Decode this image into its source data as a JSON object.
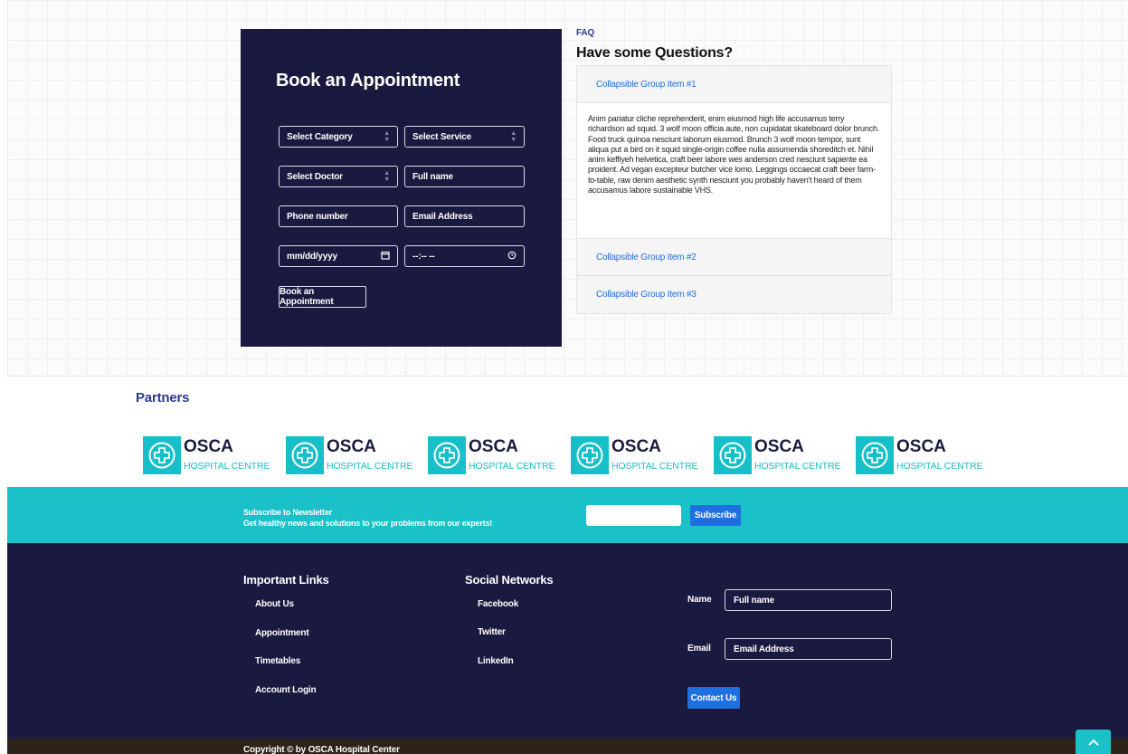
{
  "appointment": {
    "title": "Book an Appointment",
    "category_select": "Select Category",
    "service_select": "Select Service",
    "doctor_select": "Select Doctor",
    "fullname_placeholder": "Full name",
    "phone_placeholder": "Phone number",
    "email_placeholder": "Email Address",
    "date_placeholder": "mm/dd/yyyy",
    "time_placeholder": "--:-- --",
    "submit_label": "Book an Appointment"
  },
  "faq": {
    "label": "FAQ",
    "title": "Have some Questions?",
    "items": [
      {
        "title": "Collapsible Group Item #1",
        "body": "Anim pariatur cliche reprehenderit, enim eiusmod high life accusamus terry richardson ad squid. 3 wolf moon officia aute, non cupidatat skateboard dolor brunch. Food truck quinoa nesciunt laborum eiusmod. Brunch 3 wolf moon tempor, sunt aliqua put a bird on it squid single-origin coffee nulla assumenda shoreditch et. Nihil anim keffiyeh helvetica, craft beer labore wes anderson cred nesciunt sapiente ea proident. Ad vegan excepteur butcher vice lomo. Leggings occaecat craft beer farm-to-table, raw denim aesthetic synth nesciunt you probably haven't heard of them accusamus labore sustainable VHS."
      },
      {
        "title": "Collapsible Group Item #2"
      },
      {
        "title": "Collapsible Group Item #3"
      }
    ]
  },
  "partners": {
    "title": "Partners",
    "logo_name": "OSCA",
    "logo_sub": "HOSPITAL CENTRE",
    "brand_color": "#17bfc8"
  },
  "newsletter": {
    "line1": "Subscribe to Newsletter",
    "line2": "Get healthy news and solutions to your problems from our experts!",
    "button": "Subscribe"
  },
  "footer": {
    "important_title": "Important Links",
    "important_links": [
      "About Us",
      "Appointment",
      "Timetables",
      "Account Login"
    ],
    "social_title": "Social Networks",
    "social_links": [
      "Facebook",
      "Twitter",
      "LinkedIn"
    ],
    "name_label": "Name",
    "name_placeholder": "Full name",
    "email_label": "Email",
    "email_placeholder": "Email Address",
    "contact_button": "Contact Us",
    "copyright": "Copyright © by OSCA Hospital Center"
  },
  "colors": {
    "navy": "#1a1a40",
    "teal": "#1bc1c9",
    "blue": "#1f6fe0"
  }
}
